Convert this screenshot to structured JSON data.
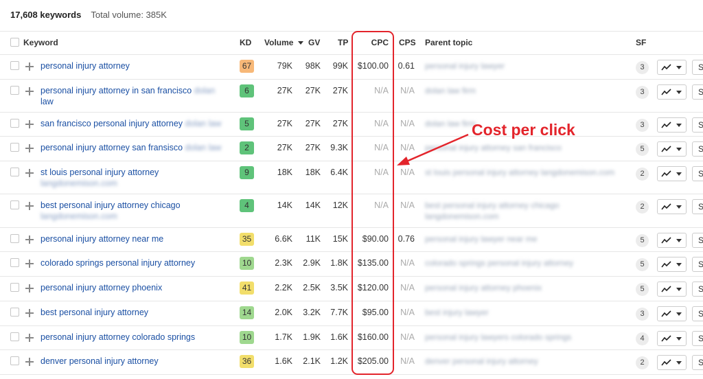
{
  "summary": {
    "keyword_count": "17,608 keywords",
    "total_volume": "Total volume: 385K"
  },
  "columns": {
    "keyword": "Keyword",
    "kd": "KD",
    "volume": "Volume",
    "gv": "GV",
    "tp": "TP",
    "cpc": "CPC",
    "cps": "CPS",
    "parent_topic": "Parent topic",
    "sf": "SF"
  },
  "sort": {
    "column": "volume",
    "direction": "descending",
    "icon": "caret-down-icon"
  },
  "rows": [
    {
      "keyword": "personal injury attorney",
      "kw_blur": "",
      "kw_blur2": "",
      "kd": "67",
      "kd_color": "#f7b878",
      "volume": "79K",
      "gv": "98K",
      "tp": "99K",
      "cpc": "$100.00",
      "cps": "0.61",
      "parent": "personal injury lawyer",
      "parent2": "",
      "sf": "3",
      "s": "S"
    },
    {
      "keyword": "personal injury attorney in san francisco",
      "kw_blur": "dolan",
      "kw_blur2": "",
      "kw_tail": "law",
      "kd": "6",
      "kd_color": "#5fc37a",
      "volume": "27K",
      "gv": "27K",
      "tp": "27K",
      "cpc": "N/A",
      "cps": "N/A",
      "parent": "dolan law firm",
      "parent2": "",
      "sf": "3",
      "s": "S"
    },
    {
      "keyword": "san francisco personal injury attorney",
      "kw_blur": "dolan law",
      "kw_blur2": "",
      "kd": "5",
      "kd_color": "#5fc37a",
      "volume": "27K",
      "gv": "27K",
      "tp": "27K",
      "cpc": "N/A",
      "cps": "N/A",
      "parent": "dolan law firm",
      "parent2": "",
      "sf": "3",
      "s": "S"
    },
    {
      "keyword": "personal injury attorney san fransisco",
      "kw_blur": "dolan law",
      "kw_blur2": "",
      "kd": "2",
      "kd_color": "#5fc37a",
      "volume": "27K",
      "gv": "27K",
      "tp": "9.3K",
      "cpc": "N/A",
      "cps": "N/A",
      "parent": "personal injury attorney san francisco",
      "parent2": "",
      "sf": "5",
      "s": "S"
    },
    {
      "keyword": "st louis personal injury attorney",
      "kw_blur": "",
      "kw_blur2": "langdonemison.com",
      "kd": "9",
      "kd_color": "#5fc37a",
      "volume": "18K",
      "gv": "18K",
      "tp": "6.4K",
      "cpc": "N/A",
      "cps": "N/A",
      "parent": "st louis personal injury attorney langdonemison.com",
      "parent2": "",
      "sf": "2",
      "s": "S"
    },
    {
      "keyword": "best personal injury attorney chicago",
      "kw_blur": "",
      "kw_blur2": "langdonemison.com",
      "kd": "4",
      "kd_color": "#5fc37a",
      "volume": "14K",
      "gv": "14K",
      "tp": "12K",
      "cpc": "N/A",
      "cps": "N/A",
      "parent": "best personal injury attorney chicago",
      "parent2": "langdonemison.com",
      "sf": "2",
      "s": "S"
    },
    {
      "keyword": "personal injury attorney near me",
      "kw_blur": "",
      "kw_blur2": "",
      "kd": "35",
      "kd_color": "#f2de6b",
      "volume": "6.6K",
      "gv": "11K",
      "tp": "15K",
      "cpc": "$90.00",
      "cps": "0.76",
      "parent": "personal injury lawyer near me",
      "parent2": "",
      "sf": "5",
      "s": "S"
    },
    {
      "keyword": "colorado springs personal injury attorney",
      "kw_blur": "",
      "kw_blur2": "",
      "kd": "10",
      "kd_color": "#9fd88f",
      "volume": "2.3K",
      "gv": "2.9K",
      "tp": "1.8K",
      "cpc": "$135.00",
      "cps": "N/A",
      "parent": "colorado springs personal injury attorney",
      "parent2": "",
      "sf": "5",
      "s": "S"
    },
    {
      "keyword": "personal injury attorney phoenix",
      "kw_blur": "",
      "kw_blur2": "",
      "kd": "41",
      "kd_color": "#f2de6b",
      "volume": "2.2K",
      "gv": "2.5K",
      "tp": "3.5K",
      "cpc": "$120.00",
      "cps": "N/A",
      "parent": "personal injury attorney phoenix",
      "parent2": "",
      "sf": "5",
      "s": "S"
    },
    {
      "keyword": "best personal injury attorney",
      "kw_blur": "",
      "kw_blur2": "",
      "kd": "14",
      "kd_color": "#9fd88f",
      "volume": "2.0K",
      "gv": "3.2K",
      "tp": "7.7K",
      "cpc": "$95.00",
      "cps": "N/A",
      "parent": "best injury lawyer",
      "parent2": "",
      "sf": "3",
      "s": "S"
    },
    {
      "keyword": "personal injury attorney colorado springs",
      "kw_blur": "",
      "kw_blur2": "",
      "kd": "10",
      "kd_color": "#9fd88f",
      "volume": "1.7K",
      "gv": "1.9K",
      "tp": "1.6K",
      "cpc": "$160.00",
      "cps": "N/A",
      "parent": "personal injury lawyers colorado springs",
      "parent2": "",
      "sf": "4",
      "s": "S"
    },
    {
      "keyword": "denver personal injury attorney",
      "kw_blur": "",
      "kw_blur2": "",
      "kd": "36",
      "kd_color": "#f2de6b",
      "volume": "1.6K",
      "gv": "2.1K",
      "tp": "1.2K",
      "cpc": "$205.00",
      "cps": "N/A",
      "parent": "denver personal injury attorney",
      "parent2": "",
      "sf": "2",
      "s": "S"
    }
  ],
  "annotation": {
    "text": "Cost per click",
    "color": "#e3242b",
    "target_column": "cpc"
  },
  "icons": {
    "trend": "trend-line-icon",
    "expand": "plus-icon",
    "dropdown": "chevron-down-icon"
  }
}
